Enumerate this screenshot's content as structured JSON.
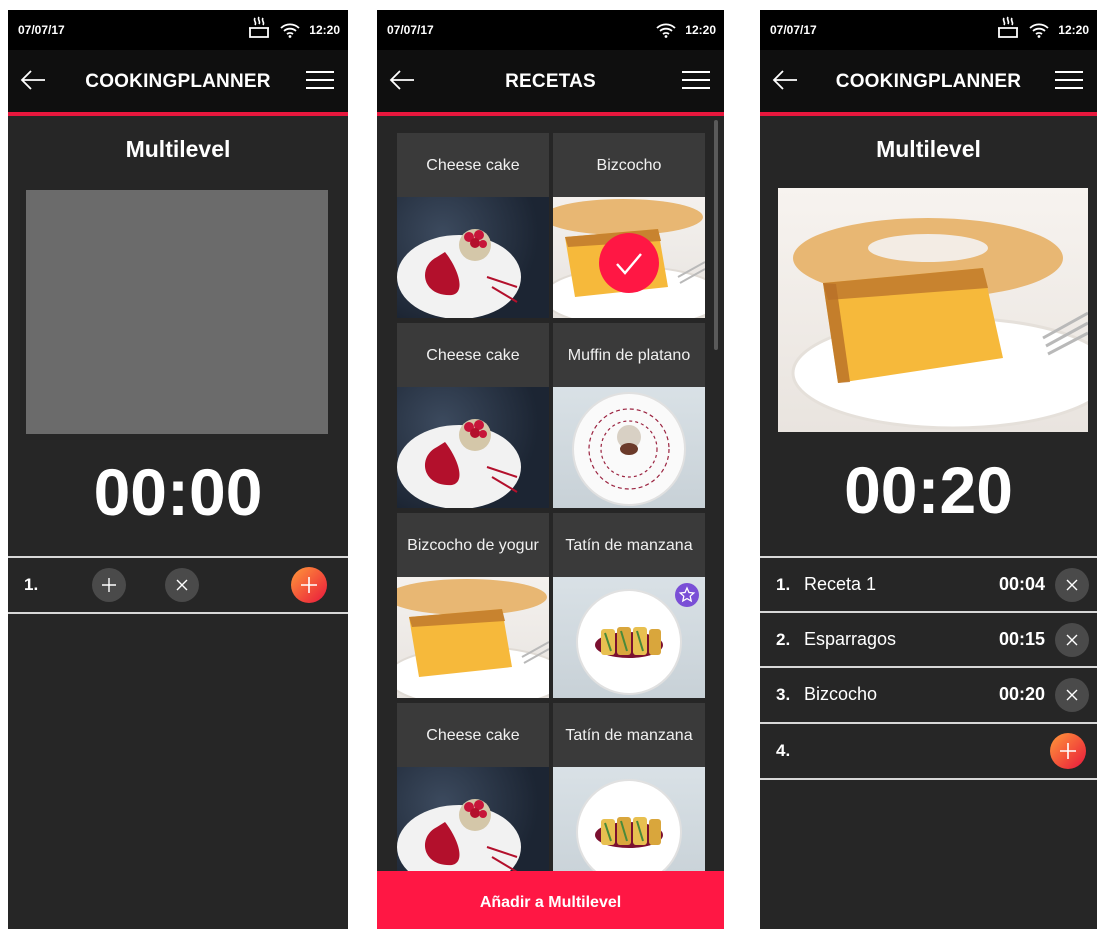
{
  "status": {
    "date": "07/07/17",
    "time": "12:20"
  },
  "screen1": {
    "title": "COOKINGPLANNER",
    "section": "Multilevel",
    "timer": "00:00",
    "row_number": "1."
  },
  "screen2": {
    "title": "RECETAS",
    "recipes": [
      {
        "label": "Cheese cake",
        "photo": "cheesecake",
        "selected": false,
        "favorite": false
      },
      {
        "label": "Bizcocho",
        "photo": "sponge-cake",
        "selected": true,
        "favorite": false
      },
      {
        "label": "Cheese cake",
        "photo": "cheesecake",
        "selected": false,
        "favorite": false
      },
      {
        "label": "Muffin de platano",
        "photo": "muffin",
        "selected": false,
        "favorite": false
      },
      {
        "label": "Bizcocho de yogur",
        "photo": "sponge-cake",
        "selected": false,
        "favorite": false
      },
      {
        "label": "Tatín de manzana",
        "photo": "tatin",
        "selected": false,
        "favorite": true
      },
      {
        "label": "Cheese cake",
        "photo": "cheesecake",
        "selected": false,
        "favorite": false
      },
      {
        "label": "Tatín de manzana",
        "photo": "tatin",
        "selected": false,
        "favorite": false
      }
    ],
    "add_button": "Añadir a Multilevel"
  },
  "screen3": {
    "title": "COOKINGPLANNER",
    "section": "Multilevel",
    "timer": "00:20",
    "items": [
      {
        "number": "1.",
        "name": "Receta 1",
        "time": "00:04"
      },
      {
        "number": "2.",
        "name": "Esparragos",
        "time": "00:15"
      },
      {
        "number": "3.",
        "name": "Bizcocho",
        "time": "00:20"
      }
    ],
    "next_number": "4."
  },
  "colors": {
    "accent": "#e8173d",
    "add_bar": "#ff1744",
    "background": "#262626",
    "header": "#0f0f0f"
  },
  "icons": [
    "back-arrow-icon",
    "hamburger-menu-icon",
    "wifi-icon",
    "steam-icon",
    "plus-icon",
    "close-icon",
    "check-icon",
    "star-icon"
  ]
}
